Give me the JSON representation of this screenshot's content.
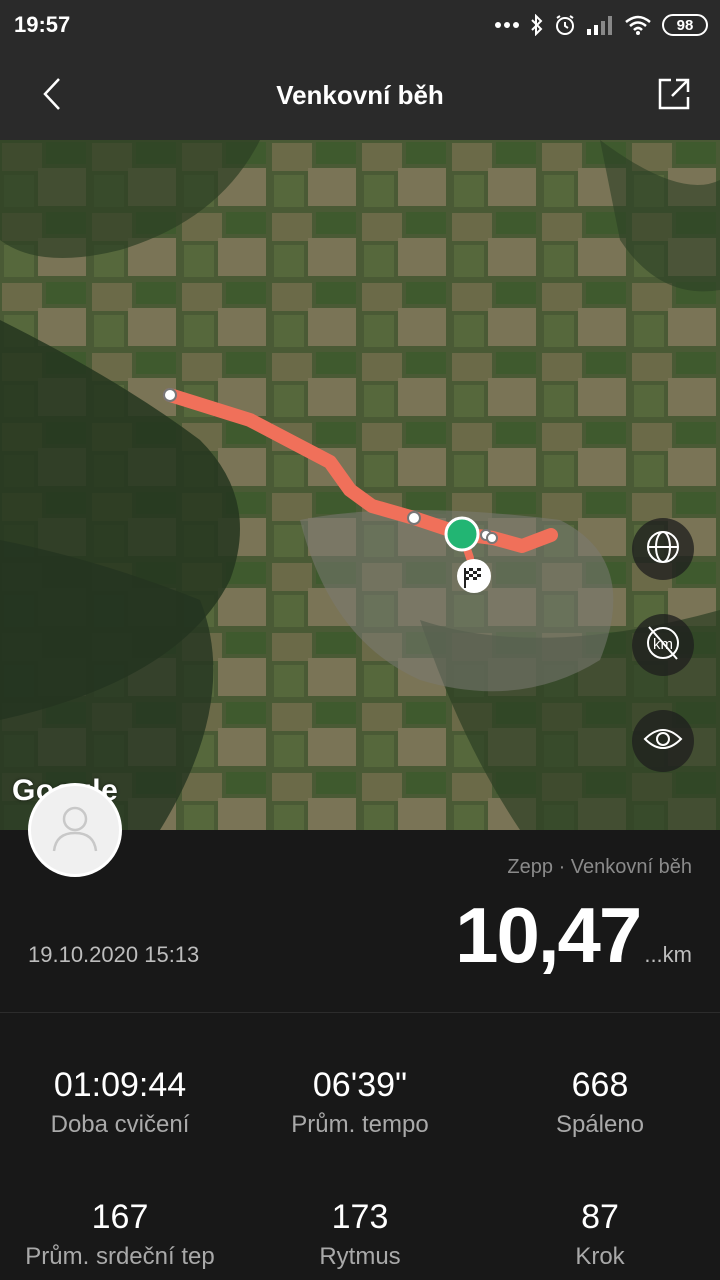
{
  "status_bar": {
    "time": "19:57",
    "battery": "98",
    "icons": [
      "dots-icon",
      "bluetooth-icon",
      "alarm-icon",
      "signal-icon",
      "wifi-icon",
      "battery-icon"
    ]
  },
  "header": {
    "title": "Venkovní běh",
    "back_icon": "chevron-left-icon",
    "share_icon": "share-icon"
  },
  "map": {
    "watermark": "Google",
    "route_color": "#F0705A",
    "start_color": "#22B573",
    "buttons": [
      "globe-icon",
      "km-marker-toggle-icon",
      "eye-icon"
    ]
  },
  "activity": {
    "source": "Zepp · Venkovní běh",
    "date": "19.10.2020 15:13",
    "distance": "10,47",
    "distance_unit": "...km"
  },
  "stats": [
    {
      "value": "01:09:44",
      "label": "Doba cvičení"
    },
    {
      "value": "06'39\"",
      "label": "Prům. tempo"
    },
    {
      "value": "668",
      "label": "Spáleno"
    },
    {
      "value": "167",
      "label": "Prům. srdeční tep"
    },
    {
      "value": "173",
      "label": "Rytmus"
    },
    {
      "value": "87",
      "label": "Krok"
    }
  ]
}
